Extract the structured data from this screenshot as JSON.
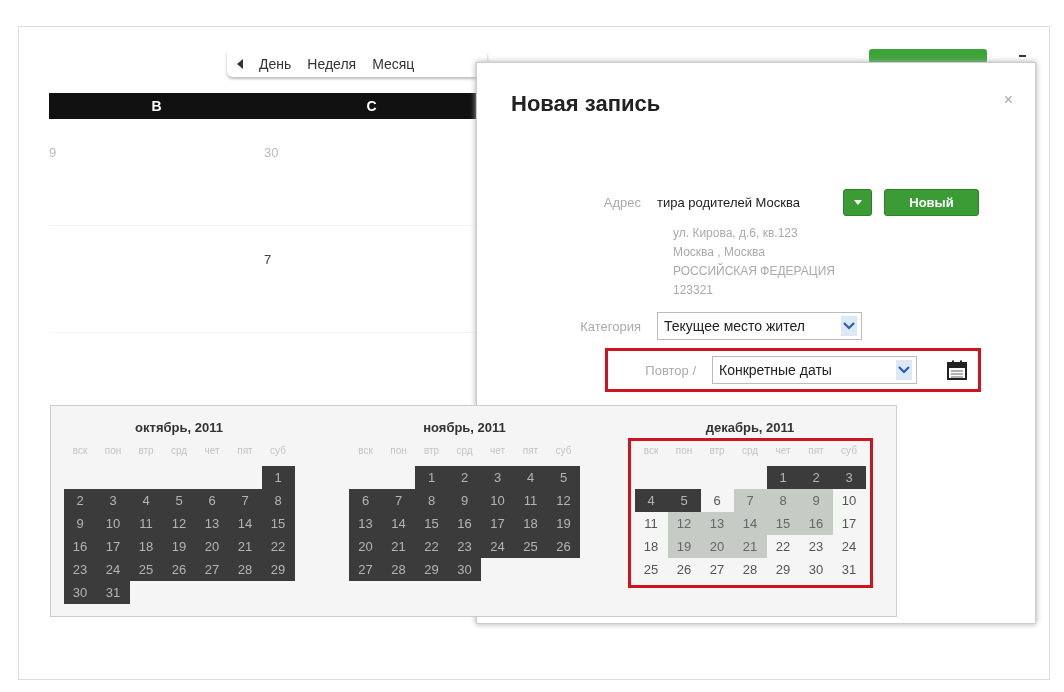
{
  "toolbar": {
    "views": [
      {
        "label": "День",
        "selected": false
      },
      {
        "label": "Неделя",
        "selected": false
      },
      {
        "label": "Месяц",
        "selected": false
      }
    ]
  },
  "calendar": {
    "columns": [
      "В",
      "С"
    ],
    "weeks": [
      {
        "kind": "full",
        "cells": [
          {
            "label": "9",
            "other_month": true
          },
          {
            "label": "30",
            "other_month": true
          }
        ]
      },
      {
        "kind": "lead",
        "cells": [
          {
            "label": "7",
            "other_month": false
          }
        ]
      }
    ]
  },
  "dialog": {
    "title": "Новая запись",
    "close": "×",
    "address": {
      "label": "Адрес",
      "value": "тира родителей Москва",
      "new_button": "Новый",
      "lines": [
        "ул. Кирова, д.6, кв.123",
        "Москва , Москва",
        "РОССИЙСКАЯ ФЕДЕРАЦИЯ",
        "123321"
      ]
    },
    "category": {
      "label": "Категория",
      "value": "Текущее место жител"
    },
    "repeat": {
      "label": "Повтор /",
      "value": "Конкретные даты",
      "highlighted": true
    }
  },
  "datepicker": {
    "months": [
      {
        "title": "октябрь, 2011",
        "highlighted": false,
        "weekdays": [
          "вск",
          "пон",
          "втр",
          "срд",
          "чет",
          "пят",
          "суб"
        ],
        "weeks": [
          {
            "kind": "lead",
            "days": [
              {
                "label": "1",
                "past": true,
                "selected": false
              }
            ]
          },
          {
            "kind": "full",
            "days": [
              {
                "label": "2",
                "past": true,
                "selected": false
              },
              {
                "label": "3",
                "past": true,
                "selected": false
              },
              {
                "label": "4",
                "past": true,
                "selected": false
              },
              {
                "label": "5",
                "past": true,
                "selected": false
              },
              {
                "label": "6",
                "past": true,
                "selected": false
              },
              {
                "label": "7",
                "past": true,
                "selected": false
              },
              {
                "label": "8",
                "past": true,
                "selected": false
              }
            ]
          },
          {
            "kind": "full",
            "days": [
              {
                "label": "9",
                "past": true,
                "selected": false
              },
              {
                "label": "10",
                "past": true,
                "selected": false
              },
              {
                "label": "11",
                "past": true,
                "selected": false
              },
              {
                "label": "12",
                "past": true,
                "selected": false
              },
              {
                "label": "13",
                "past": true,
                "selected": false
              },
              {
                "label": "14",
                "past": true,
                "selected": false
              },
              {
                "label": "15",
                "past": true,
                "selected": false
              }
            ]
          },
          {
            "kind": "full",
            "days": [
              {
                "label": "16",
                "past": true,
                "selected": false
              },
              {
                "label": "17",
                "past": true,
                "selected": false
              },
              {
                "label": "18",
                "past": true,
                "selected": false
              },
              {
                "label": "19",
                "past": true,
                "selected": false
              },
              {
                "label": "20",
                "past": true,
                "selected": false
              },
              {
                "label": "21",
                "past": true,
                "selected": false
              },
              {
                "label": "22",
                "past": true,
                "selected": false
              }
            ]
          },
          {
            "kind": "full",
            "days": [
              {
                "label": "23",
                "past": true,
                "selected": false
              },
              {
                "label": "24",
                "past": true,
                "selected": false
              },
              {
                "label": "25",
                "past": true,
                "selected": false
              },
              {
                "label": "26",
                "past": true,
                "selected": false
              },
              {
                "label": "27",
                "past": true,
                "selected": false
              },
              {
                "label": "28",
                "past": true,
                "selected": false
              },
              {
                "label": "29",
                "past": true,
                "selected": false
              }
            ]
          },
          {
            "kind": "full",
            "days": [
              {
                "label": "30",
                "past": true,
                "selected": false
              },
              {
                "label": "31",
                "past": true,
                "selected": false
              }
            ]
          }
        ]
      },
      {
        "title": "ноябрь, 2011",
        "highlighted": false,
        "weekdays": [
          "вск",
          "пон",
          "втр",
          "срд",
          "чет",
          "пят",
          "суб"
        ],
        "weeks": [
          {
            "kind": "lead",
            "days": [
              {
                "label": "1",
                "past": true,
                "selected": false
              },
              {
                "label": "2",
                "past": true,
                "selected": false
              },
              {
                "label": "3",
                "past": true,
                "selected": false
              },
              {
                "label": "4",
                "past": true,
                "selected": false
              },
              {
                "label": "5",
                "past": true,
                "selected": false
              }
            ]
          },
          {
            "kind": "full",
            "days": [
              {
                "label": "6",
                "past": true,
                "selected": false
              },
              {
                "label": "7",
                "past": true,
                "selected": false
              },
              {
                "label": "8",
                "past": true,
                "selected": false
              },
              {
                "label": "9",
                "past": true,
                "selected": false
              },
              {
                "label": "10",
                "past": true,
                "selected": false
              },
              {
                "label": "11",
                "past": true,
                "selected": false
              },
              {
                "label": "12",
                "past": true,
                "selected": false
              }
            ]
          },
          {
            "kind": "full",
            "days": [
              {
                "label": "13",
                "past": true,
                "selected": false
              },
              {
                "label": "14",
                "past": true,
                "selected": false
              },
              {
                "label": "15",
                "past": true,
                "selected": false
              },
              {
                "label": "16",
                "past": true,
                "selected": false
              },
              {
                "label": "17",
                "past": true,
                "selected": false
              },
              {
                "label": "18",
                "past": true,
                "selected": false
              },
              {
                "label": "19",
                "past": true,
                "selected": false
              }
            ]
          },
          {
            "kind": "full",
            "days": [
              {
                "label": "20",
                "past": true,
                "selected": false
              },
              {
                "label": "21",
                "past": true,
                "selected": false
              },
              {
                "label": "22",
                "past": true,
                "selected": false
              },
              {
                "label": "23",
                "past": true,
                "selected": false
              },
              {
                "label": "24",
                "past": true,
                "selected": false
              },
              {
                "label": "25",
                "past": true,
                "selected": false
              },
              {
                "label": "26",
                "past": true,
                "selected": false
              }
            ]
          },
          {
            "kind": "full",
            "days": [
              {
                "label": "27",
                "past": true,
                "selected": false
              },
              {
                "label": "28",
                "past": true,
                "selected": false
              },
              {
                "label": "29",
                "past": true,
                "selected": false
              },
              {
                "label": "30",
                "past": true,
                "selected": false
              }
            ]
          }
        ]
      },
      {
        "title": "декабрь, 2011",
        "highlighted": true,
        "weekdays": [
          "вск",
          "пон",
          "втр",
          "срд",
          "чет",
          "пят",
          "суб"
        ],
        "weeks": [
          {
            "kind": "lead",
            "days": [
              {
                "label": "1",
                "past": true,
                "selected": false
              },
              {
                "label": "2",
                "past": true,
                "selected": false
              },
              {
                "label": "3",
                "past": true,
                "selected": false
              }
            ]
          },
          {
            "kind": "full",
            "days": [
              {
                "label": "4",
                "past": true,
                "selected": false
              },
              {
                "label": "5",
                "past": true,
                "selected": false
              },
              {
                "label": "6",
                "past": false,
                "selected": false
              },
              {
                "label": "7",
                "past": false,
                "selected": true
              },
              {
                "label": "8",
                "past": false,
                "selected": true
              },
              {
                "label": "9",
                "past": false,
                "selected": true
              },
              {
                "label": "10",
                "past": false,
                "selected": false
              }
            ]
          },
          {
            "kind": "full",
            "days": [
              {
                "label": "11",
                "past": false,
                "selected": false
              },
              {
                "label": "12",
                "past": false,
                "selected": true
              },
              {
                "label": "13",
                "past": false,
                "selected": true
              },
              {
                "label": "14",
                "past": false,
                "selected": true
              },
              {
                "label": "15",
                "past": false,
                "selected": true
              },
              {
                "label": "16",
                "past": false,
                "selected": true
              },
              {
                "label": "17",
                "past": false,
                "selected": false
              }
            ]
          },
          {
            "kind": "full",
            "days": [
              {
                "label": "18",
                "past": false,
                "selected": false
              },
              {
                "label": "19",
                "past": false,
                "selected": true
              },
              {
                "label": "20",
                "past": false,
                "selected": true
              },
              {
                "label": "21",
                "past": false,
                "selected": true
              },
              {
                "label": "22",
                "past": false,
                "selected": false
              },
              {
                "label": "23",
                "past": false,
                "selected": false
              },
              {
                "label": "24",
                "past": false,
                "selected": false
              }
            ]
          },
          {
            "kind": "full",
            "days": [
              {
                "label": "25",
                "past": false,
                "selected": false
              },
              {
                "label": "26",
                "past": false,
                "selected": false
              },
              {
                "label": "27",
                "past": false,
                "selected": false
              },
              {
                "label": "28",
                "past": false,
                "selected": false
              },
              {
                "label": "29",
                "past": false,
                "selected": false
              },
              {
                "label": "30",
                "past": false,
                "selected": false
              },
              {
                "label": "31",
                "past": false,
                "selected": false
              }
            ]
          }
        ]
      }
    ]
  }
}
